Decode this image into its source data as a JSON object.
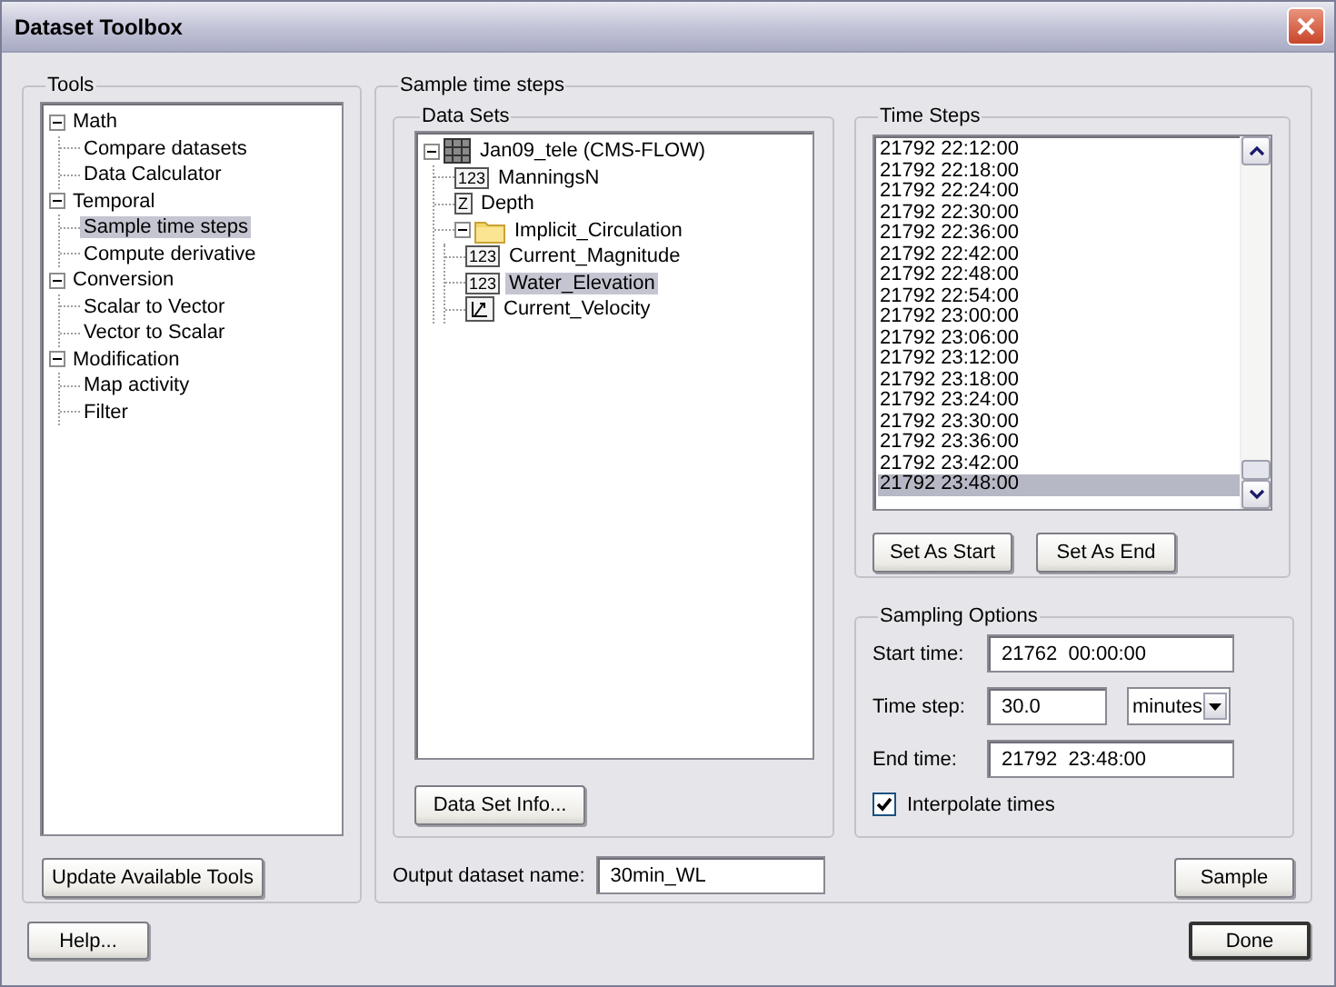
{
  "window": {
    "title": "Dataset Toolbox"
  },
  "tools": {
    "title": "Tools",
    "update_button": "Update Available Tools",
    "tree": [
      {
        "label": "Math",
        "expanded": true,
        "selected": false,
        "children": [
          {
            "label": "Compare datasets",
            "selected": false
          },
          {
            "label": "Data Calculator",
            "selected": false
          }
        ]
      },
      {
        "label": "Temporal",
        "expanded": true,
        "selected": false,
        "children": [
          {
            "label": "Sample time steps",
            "selected": true
          },
          {
            "label": "Compute derivative",
            "selected": false
          }
        ]
      },
      {
        "label": "Conversion",
        "expanded": true,
        "selected": false,
        "children": [
          {
            "label": "Scalar to Vector",
            "selected": false
          },
          {
            "label": "Vector to Scalar",
            "selected": false
          }
        ]
      },
      {
        "label": "Modification",
        "expanded": true,
        "selected": false,
        "children": [
          {
            "label": "Map activity",
            "selected": false
          },
          {
            "label": "Filter",
            "selected": false
          }
        ]
      }
    ]
  },
  "sample": {
    "title": "Sample time steps",
    "data_sets": {
      "title": "Data Sets",
      "info_button": "Data Set Info...",
      "tree": [
        {
          "label": "Jan09_tele (CMS-FLOW)",
          "kind": "mesh",
          "expanded": true,
          "selected": false,
          "children": [
            {
              "label": "ManningsN",
              "kind": "scalar",
              "badge": "123",
              "selected": false
            },
            {
              "label": "Depth",
              "kind": "scalar",
              "badge": "Z",
              "selected": false
            },
            {
              "label": "Implicit_Circulation",
              "kind": "folder",
              "expanded": true,
              "selected": false,
              "children": [
                {
                  "label": "Current_Magnitude",
                  "kind": "scalar",
                  "badge": "123",
                  "selected": false
                },
                {
                  "label": "Water_Elevation",
                  "kind": "scalar",
                  "badge": "123",
                  "selected": true
                },
                {
                  "label": "Current_Velocity",
                  "kind": "vector",
                  "selected": false
                }
              ]
            }
          ]
        }
      ]
    },
    "output": {
      "label": "Output dataset name:",
      "value": "30min_WL"
    },
    "time_steps": {
      "title": "Time Steps",
      "buttons": [
        "Set As Start",
        "Set As End"
      ],
      "items": [
        {
          "label": "21792 22:12:00",
          "selected": false
        },
        {
          "label": "21792 22:18:00",
          "selected": false
        },
        {
          "label": "21792 22:24:00",
          "selected": false
        },
        {
          "label": "21792 22:30:00",
          "selected": false
        },
        {
          "label": "21792 22:36:00",
          "selected": false
        },
        {
          "label": "21792 22:42:00",
          "selected": false
        },
        {
          "label": "21792 22:48:00",
          "selected": false
        },
        {
          "label": "21792 22:54:00",
          "selected": false
        },
        {
          "label": "21792 23:00:00",
          "selected": false
        },
        {
          "label": "21792 23:06:00",
          "selected": false
        },
        {
          "label": "21792 23:12:00",
          "selected": false
        },
        {
          "label": "21792 23:18:00",
          "selected": false
        },
        {
          "label": "21792 23:24:00",
          "selected": false
        },
        {
          "label": "21792 23:30:00",
          "selected": false
        },
        {
          "label": "21792 23:36:00",
          "selected": false
        },
        {
          "label": "21792 23:42:00",
          "selected": false
        },
        {
          "label": "21792 23:48:00",
          "selected": true
        }
      ]
    },
    "sampling_options": {
      "title": "Sampling Options",
      "start_time": {
        "label": "Start time:",
        "value": "21762  00:00:00"
      },
      "time_step": {
        "label": "Time step:",
        "value": "30.0",
        "unit": "minutes"
      },
      "end_time": {
        "label": "End time:",
        "value": "21792  23:48:00"
      },
      "interpolate": {
        "label": "Interpolate times",
        "checked": true
      }
    },
    "sample_button": "Sample"
  },
  "buttons": {
    "help": "Help...",
    "done": "Done"
  }
}
